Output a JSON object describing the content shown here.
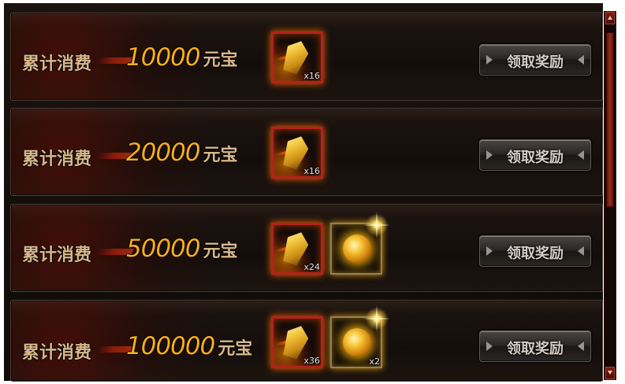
{
  "rewards_list": {
    "rows": [
      {
        "label": "累计消费",
        "amount": "10000",
        "currency": "元宝",
        "button_label": "领取奖励",
        "rewards": [
          {
            "icon": "crystal-icon",
            "quantity": "x16"
          }
        ]
      },
      {
        "label": "累计消费",
        "amount": "20000",
        "currency": "元宝",
        "button_label": "领取奖励",
        "rewards": [
          {
            "icon": "crystal-icon",
            "quantity": "x16"
          }
        ]
      },
      {
        "label": "累计消费",
        "amount": "50000",
        "currency": "元宝",
        "button_label": "领取奖励",
        "rewards": [
          {
            "icon": "crystal-icon",
            "quantity": "x24"
          },
          {
            "icon": "golden-orb-icon",
            "quantity": ""
          }
        ]
      },
      {
        "label": "累计消费",
        "amount": "100000",
        "currency": "元宝",
        "button_label": "领取奖励",
        "rewards": [
          {
            "icon": "crystal-icon",
            "quantity": "x36"
          },
          {
            "icon": "golden-orb-icon",
            "quantity": "x2"
          }
        ]
      }
    ]
  },
  "scrollbar": {
    "position_fraction": 0.0,
    "up_icon": "arrow-up-icon",
    "down_icon": "arrow-down-icon"
  },
  "colors": {
    "amount": "#f7ad18",
    "label": "#d8b78a",
    "panel_background": "#160f0b",
    "scroll_accent": "#9a2a18"
  }
}
